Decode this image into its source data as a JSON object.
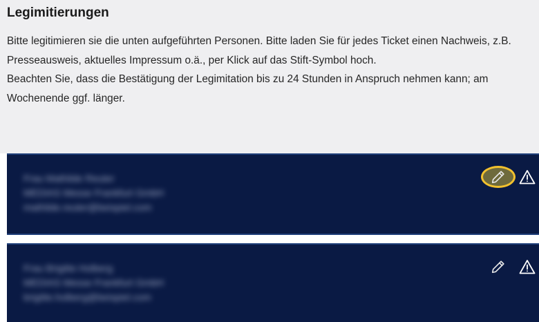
{
  "heading": "Legimitierungen",
  "intro": {
    "p1": "Bitte legitimieren sie die unten aufgeführten Personen. Bitte laden Sie für jedes Ticket einen Nachweis, z.B. Presseausweis, aktuelles Impressum o.ä., per Klick auf das Stift-Symbol hoch.",
    "p2": "Beachten Sie, dass die Bestätigung der Legimitation bis zu 24 Stunden in Anspruch nehmen kann; am Wochenende ggf. länger."
  },
  "persons": [
    {
      "name": "Frau Mathilde Reuter",
      "company": "MEDIAS Messe Frankfurt GmbH",
      "email": "mathilde.reuter@beispiel.com",
      "edit_highlighted": true
    },
    {
      "name": "Frau Brigitte Holberg",
      "company": "MEDIAS Messe Frankfurt GmbH",
      "email": "brigitte.holberg@beispiel.com",
      "edit_highlighted": false
    }
  ],
  "icons": {
    "edit": "pencil-icon",
    "warning": "warning-triangle-icon"
  },
  "colors": {
    "panel_bg": "#efeff1",
    "card_bg": "#0a1a44",
    "highlight_ring": "#f2c12e"
  }
}
